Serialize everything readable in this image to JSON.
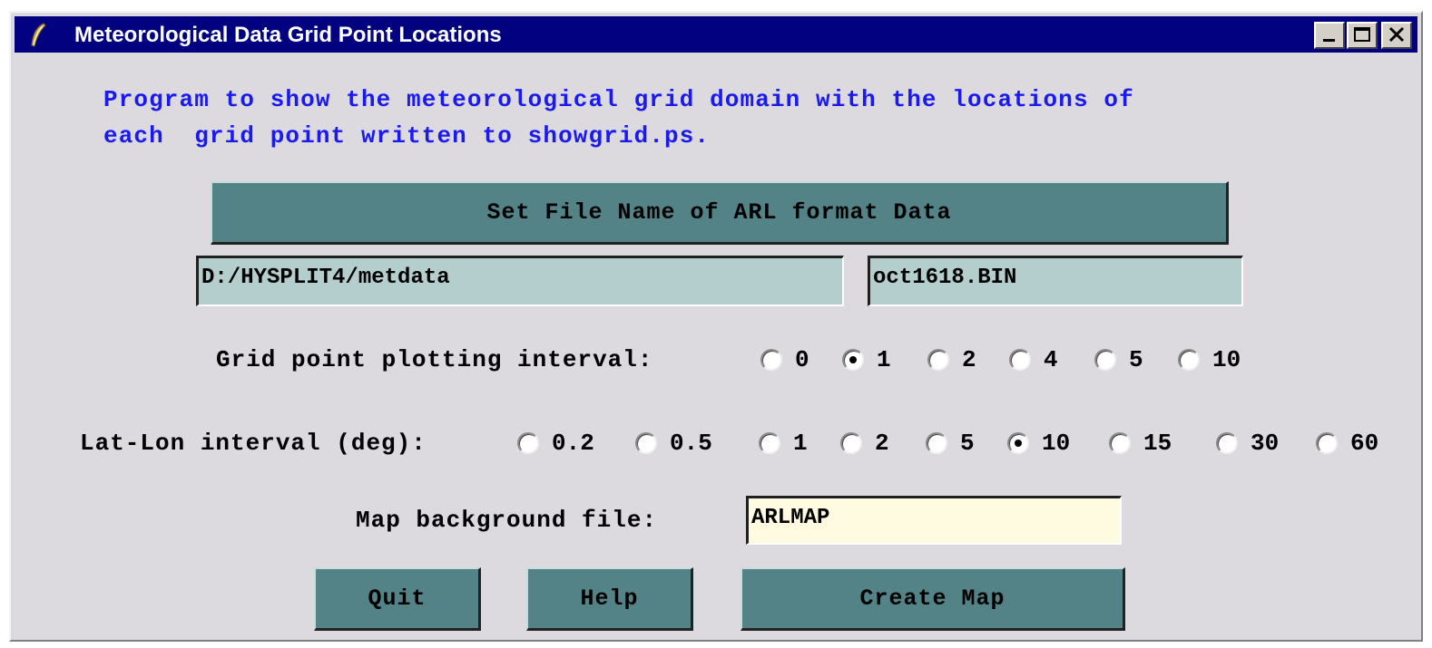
{
  "window": {
    "title": "Meteorological Data Grid Point Locations"
  },
  "description": {
    "line1": "Program to show the meteorological grid domain with the locations of",
    "line2": "each  grid point written to showgrid.ps."
  },
  "file_select": {
    "button_label": "Set File Name of ARL format Data",
    "directory_value": "D:/HYSPLIT4/metdata",
    "filename_value": "oct1618.BIN"
  },
  "grid_interval": {
    "label": "Grid point plotting interval:",
    "options": [
      "0",
      "1",
      "2",
      "4",
      "5",
      "10"
    ],
    "selected": "1"
  },
  "latlon_interval": {
    "label": "Lat-Lon interval (deg):",
    "options": [
      "0.2",
      "0.5",
      "1",
      "2",
      "5",
      "10",
      "15",
      "30",
      "60"
    ],
    "selected": "10"
  },
  "map_background": {
    "label": "Map background file:",
    "value": "ARLMAP"
  },
  "actions": {
    "quit": "Quit",
    "help": "Help",
    "create_map": "Create Map"
  },
  "colors": {
    "titlebar": "#020280",
    "window_bg": "#dcdadf",
    "button": "#548387",
    "description_text": "#1a1af0",
    "entry_bg": "#b4cdcd",
    "map_entry_bg": "#fffbe0"
  }
}
